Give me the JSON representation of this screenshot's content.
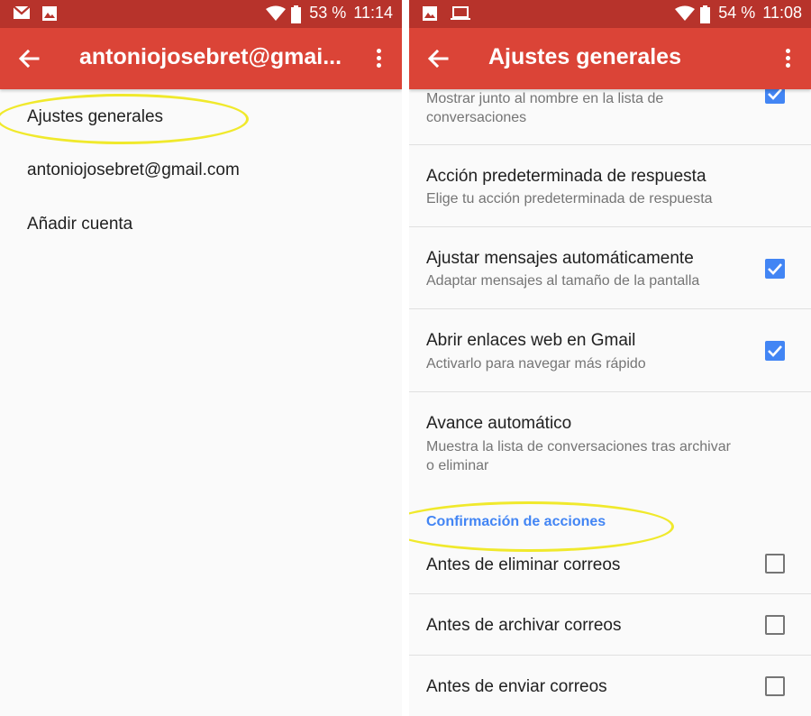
{
  "left": {
    "status": {
      "battery": "53 %",
      "time": "11:14"
    },
    "appbar": {
      "title": "antoniojosebret@gmai..."
    },
    "menu": [
      {
        "label": "Ajustes generales"
      },
      {
        "label": "antoniojosebret@gmail.com"
      },
      {
        "label": "Añadir cuenta"
      }
    ]
  },
  "right": {
    "status": {
      "battery": "54 %",
      "time": "11:08"
    },
    "appbar": {
      "title": "Ajustes generales"
    },
    "settings": [
      {
        "title": "",
        "subtitle": "Mostrar junto al nombre en la lista de conversaciones",
        "checked": true
      },
      {
        "title": "Acción predeterminada de respuesta",
        "subtitle": "Elige tu acción predeterminada de respuesta"
      },
      {
        "title": "Ajustar mensajes automáticamente",
        "subtitle": "Adaptar mensajes al tamaño de la pantalla",
        "checked": true
      },
      {
        "title": "Abrir enlaces web en Gmail",
        "subtitle": "Activarlo para navegar más rápido",
        "checked": true
      },
      {
        "title": "Avance automático",
        "subtitle": "Muestra la lista de conversaciones tras archivar o eliminar"
      }
    ],
    "section_header": "Confirmación de acciones",
    "confirm_items": [
      {
        "title": "Antes de eliminar correos",
        "checked": false
      },
      {
        "title": "Antes de archivar correos",
        "checked": false
      },
      {
        "title": "Antes de enviar correos",
        "checked": false
      }
    ]
  },
  "colors": {
    "appbar": "#db4437",
    "statusbar": "#b7332b",
    "accent": "#4285f4",
    "highlight": "#f0e92c"
  }
}
